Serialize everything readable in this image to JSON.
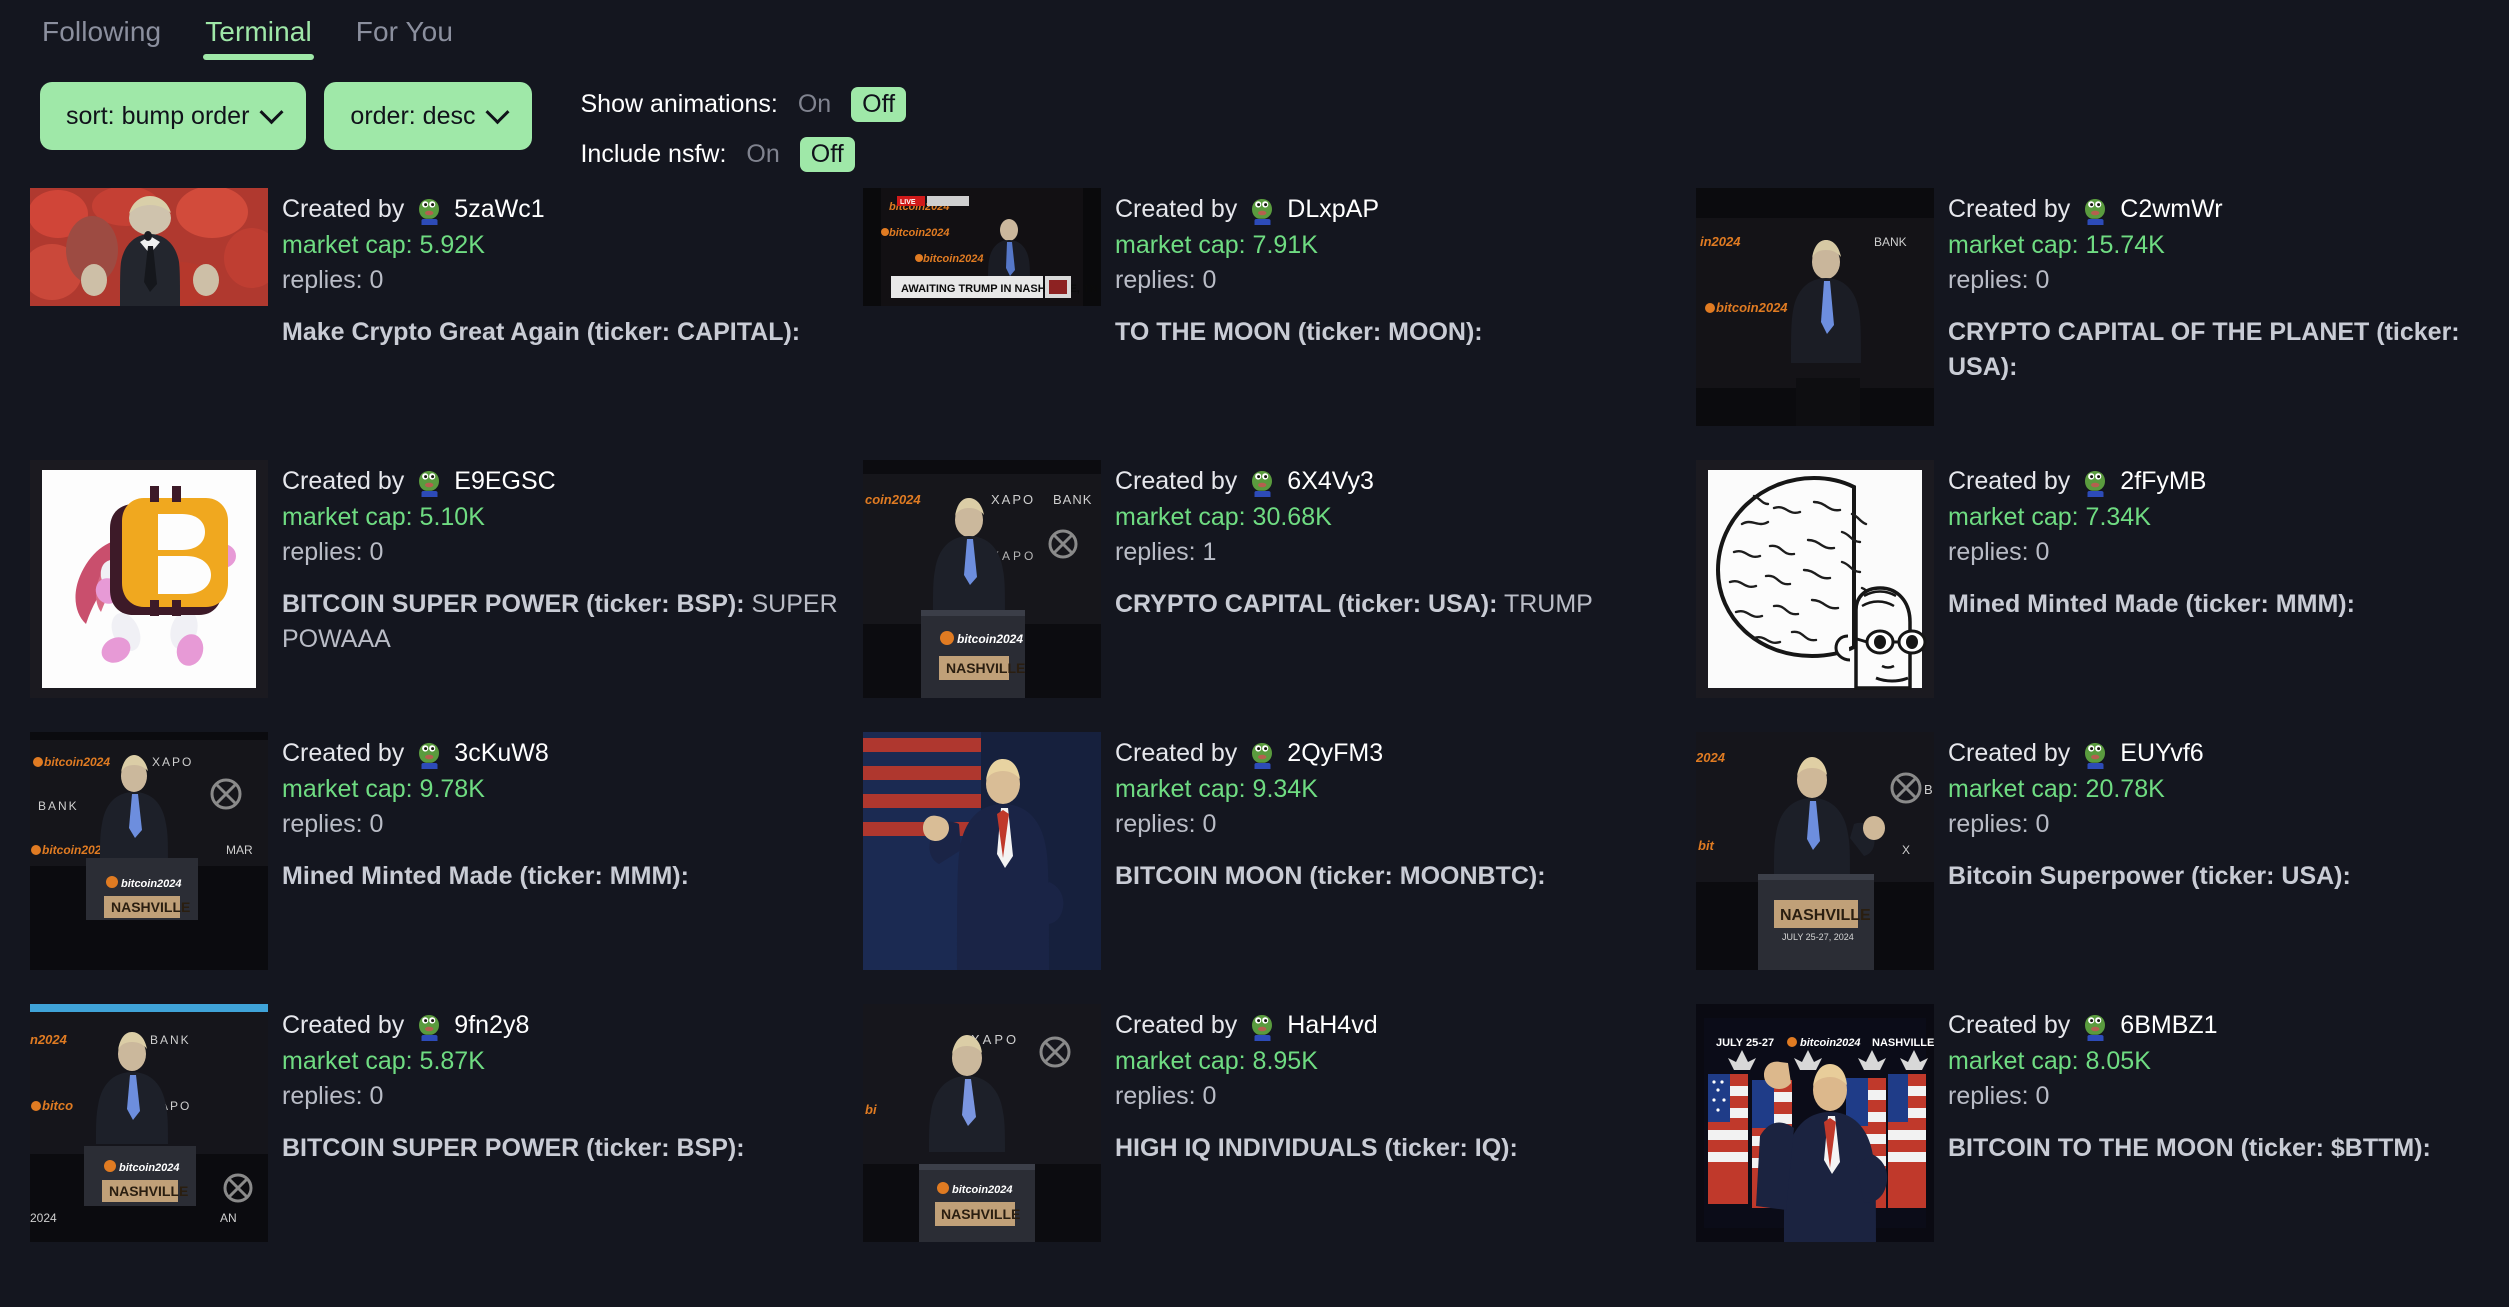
{
  "tabs": [
    {
      "label": "Following",
      "active": false
    },
    {
      "label": "Terminal",
      "active": true
    },
    {
      "label": "For You",
      "active": false
    }
  ],
  "controls": {
    "sort_button": "sort: bump order",
    "order_button": "order: desc",
    "animations": {
      "label": "Show animations:",
      "on": "On",
      "off": "Off",
      "selected": "Off"
    },
    "nsfw": {
      "label": "Include nsfw:",
      "on": "On",
      "off": "Off",
      "selected": "Off"
    }
  },
  "labels": {
    "created_by": "Created by",
    "market_cap_prefix": "market cap: ",
    "replies_prefix": "replies: "
  },
  "colors": {
    "background": "#14161f",
    "accent_green": "#9fe8a8",
    "market_cap_green": "#6fdc82",
    "muted_text": "#8b8f9e"
  },
  "coins": [
    {
      "creator": "5zaWc1",
      "market_cap": "market cap: 5.92K",
      "replies": "replies: 0",
      "title": "Make Crypto Great Again (ticker: CAPITAL):",
      "description": "",
      "thumb": "trump-red-blobs"
    },
    {
      "creator": "DLxpAP",
      "market_cap": "market cap: 7.91K",
      "replies": "replies: 0",
      "title": "TO THE MOON (ticker: MOON):",
      "description": "",
      "thumb": "news-awaiting-trump"
    },
    {
      "creator": "C2wmWr",
      "market_cap": "market cap: 15.74K",
      "replies": "replies: 0",
      "title": "CRYPTO CAPITAL OF THE PLANET (ticker: USA):",
      "description": "",
      "thumb": "trump-stage-dark"
    },
    {
      "creator": "E9EGSC",
      "market_cap": "market cap: 5.10K",
      "replies": "replies: 0",
      "title": "BITCOIN SUPER POWER (ticker: BSP):",
      "description": " SUPER POWAAA",
      "thumb": "bitcoin-superhero"
    },
    {
      "creator": "6X4Vy3",
      "market_cap": "market cap: 30.68K",
      "replies": "replies: 1",
      "title": "CRYPTO CAPITAL (ticker: USA):",
      "description": " TRUMP",
      "thumb": "trump-podium-xapo"
    },
    {
      "creator": "2fFyMB",
      "market_cap": "market cap: 7.34K",
      "replies": "replies: 0",
      "title": "Mined Minted Made (ticker: MMM):",
      "description": "",
      "thumb": "big-brain-wojak"
    },
    {
      "creator": "3cKuW8",
      "market_cap": "market cap: 9.78K",
      "replies": "replies: 0",
      "title": "Mined Minted Made (ticker: MMM):",
      "description": "",
      "thumb": "trump-nashville-banner"
    },
    {
      "creator": "2QyFM3",
      "market_cap": "market cap: 9.34K",
      "replies": "replies: 0",
      "title": "BITCOIN MOON (ticker: MOONBTC):",
      "description": "",
      "thumb": "trump-fist-flag"
    },
    {
      "creator": "EUYvf6",
      "market_cap": "market cap: 20.78K",
      "replies": "replies: 0",
      "title": "Bitcoin Superpower (ticker: USA):",
      "description": "",
      "thumb": "trump-nashville-podium"
    },
    {
      "creator": "9fn2y8",
      "market_cap": "market cap: 5.87K",
      "replies": "replies: 0",
      "title": "BITCOIN SUPER POWER (ticker: BSP):",
      "description": "",
      "thumb": "trump-nashville-wide"
    },
    {
      "creator": "HaH4vd",
      "market_cap": "market cap: 8.95K",
      "replies": "replies: 0",
      "title": "HIGH IQ INDIVIDUALS (ticker: IQ):",
      "description": "",
      "thumb": "trump-xapo-bank"
    },
    {
      "creator": "6BMBZ1",
      "market_cap": "market cap: 8.05K",
      "replies": "replies: 0",
      "title": "BITCOIN TO THE MOON (ticker: $BTTM):",
      "description": "",
      "thumb": "trump-flags-fist"
    }
  ]
}
